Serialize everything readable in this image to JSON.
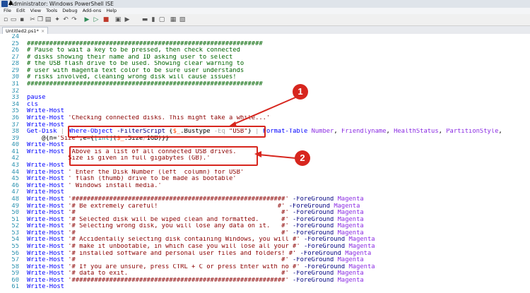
{
  "window": {
    "title": "Administrator: Windows PowerShell ISE"
  },
  "menu": [
    "File",
    "Edit",
    "View",
    "Tools",
    "Debug",
    "Add-ons",
    "Help"
  ],
  "toolbar": [
    "new-icon",
    "open-icon",
    "save-icon",
    "cut-icon",
    "copy-icon",
    "paste-icon",
    "clear-icon",
    "undo-icon",
    "redo-icon",
    "run-icon",
    "run-selection-icon",
    "stop-icon",
    "new-remote-tab-icon",
    "start-powershell-icon",
    "layout-top-icon",
    "layout-right-icon",
    "layout-max-icon",
    "show-console-icon",
    "show-commands-icon"
  ],
  "tab": {
    "name": "Untitled2.ps1*",
    "close": "×"
  },
  "lines": [
    {
      "num": "24",
      "tokens": []
    },
    {
      "num": "25",
      "tokens": [
        {
          "t": "cmt",
          "v": "###############################################################"
        }
      ]
    },
    {
      "num": "26",
      "tokens": [
        {
          "t": "cmt",
          "v": "# Pause to wait a key to be pressed, then check connected"
        }
      ]
    },
    {
      "num": "27",
      "tokens": [
        {
          "t": "cmt",
          "v": "# disks showing their name and ID asking user to select"
        }
      ]
    },
    {
      "num": "28",
      "tokens": [
        {
          "t": "cmt",
          "v": "# the USB flash drive to be used. Showing clear warning to"
        }
      ]
    },
    {
      "num": "29",
      "tokens": [
        {
          "t": "cmt",
          "v": "# user with magenta text color to be sure user understands"
        }
      ]
    },
    {
      "num": "30",
      "tokens": [
        {
          "t": "cmt",
          "v": "# risks involved, cleaning wrong disk will cause issues!"
        }
      ]
    },
    {
      "num": "31",
      "tokens": [
        {
          "t": "cmt",
          "v": "###############################################################"
        }
      ]
    },
    {
      "num": "32",
      "tokens": []
    },
    {
      "num": "33",
      "tokens": [
        {
          "t": "cmd",
          "v": "pause"
        }
      ]
    },
    {
      "num": "34",
      "tokens": [
        {
          "t": "cmd",
          "v": "cls"
        }
      ]
    },
    {
      "num": "35",
      "tokens": [
        {
          "t": "cmd",
          "v": "Write-Host"
        }
      ]
    },
    {
      "num": "36",
      "tokens": [
        {
          "t": "cmd",
          "v": "Write-Host"
        },
        {
          "t": "plain",
          "v": " "
        },
        {
          "t": "str",
          "v": "'Checking connected disks. This might take a while...'"
        }
      ]
    },
    {
      "num": "37",
      "tokens": [
        {
          "t": "cmd",
          "v": "Write-Host"
        }
      ]
    },
    {
      "num": "38",
      "tokens": [
        {
          "t": "cmd",
          "v": "Get-Disk"
        },
        {
          "t": "plain",
          "v": " "
        },
        {
          "t": "op",
          "v": "|"
        },
        {
          "t": "plain",
          "v": " "
        },
        {
          "t": "cmd",
          "v": "Where-Object"
        },
        {
          "t": "plain",
          "v": " "
        },
        {
          "t": "par",
          "v": "-FilterScript"
        },
        {
          "t": "plain",
          "v": " {"
        },
        {
          "t": "var",
          "v": "$_"
        },
        {
          "t": "plain",
          "v": "."
        },
        {
          "t": "plain",
          "v": "Bustype "
        },
        {
          "t": "op",
          "v": "-Eq"
        },
        {
          "t": "plain",
          "v": " "
        },
        {
          "t": "str",
          "v": "\"USB\""
        },
        {
          "t": "plain",
          "v": "} "
        },
        {
          "t": "op",
          "v": "|"
        },
        {
          "t": "plain",
          "v": " "
        },
        {
          "t": "cmd",
          "v": "Format-Table"
        },
        {
          "t": "plain",
          "v": " "
        },
        {
          "t": "arg",
          "v": "Number"
        },
        {
          "t": "plain",
          "v": ", "
        },
        {
          "t": "arg",
          "v": "Friendlyname"
        },
        {
          "t": "plain",
          "v": ", "
        },
        {
          "t": "arg",
          "v": "HealthStatus"
        },
        {
          "t": "plain",
          "v": ", "
        },
        {
          "t": "arg",
          "v": "PartitionStyle"
        },
        {
          "t": "plain",
          "v": ","
        }
      ]
    },
    {
      "num": "39",
      "tokens": [
        {
          "t": "plain",
          "v": "    @{n="
        },
        {
          "t": "str",
          "v": "'Size'"
        },
        {
          "t": "plain",
          "v": ";e={"
        },
        {
          "t": "typ",
          "v": "[int]"
        },
        {
          "t": "plain",
          "v": "("
        },
        {
          "t": "var",
          "v": "$_"
        },
        {
          "t": "plain",
          "v": ".Size"
        },
        {
          "t": "op",
          "v": "/"
        },
        {
          "t": "plain",
          "v": "1GB"
        },
        {
          "t": "plain",
          "v": ")}}"
        }
      ]
    },
    {
      "num": "40",
      "tokens": [
        {
          "t": "cmd",
          "v": "Write-Host"
        }
      ]
    },
    {
      "num": "41",
      "tokens": [
        {
          "t": "cmd",
          "v": "Write-Host"
        },
        {
          "t": "plain",
          "v": " "
        },
        {
          "t": "str",
          "v": "'Above is a list of all connected USB drives."
        }
      ]
    },
    {
      "num": "42",
      "tokens": [
        {
          "t": "str",
          "v": "           Size is given in full gigabytes (GB).'"
        }
      ]
    },
    {
      "num": "43",
      "tokens": [
        {
          "t": "cmd",
          "v": "Write-Host"
        }
      ]
    },
    {
      "num": "44",
      "tokens": [
        {
          "t": "cmd",
          "v": "Write-Host"
        },
        {
          "t": "plain",
          "v": " "
        },
        {
          "t": "str",
          "v": "' Enter the Disk Number (left  column) for USB'"
        }
      ]
    },
    {
      "num": "45",
      "tokens": [
        {
          "t": "cmd",
          "v": "Write-Host"
        },
        {
          "t": "plain",
          "v": " "
        },
        {
          "t": "str",
          "v": "' flash (thumb) drive to be made as bootable'"
        }
      ]
    },
    {
      "num": "46",
      "tokens": [
        {
          "t": "cmd",
          "v": "Write-Host"
        },
        {
          "t": "plain",
          "v": " "
        },
        {
          "t": "str",
          "v": "' Windows install media.'"
        }
      ]
    },
    {
      "num": "47",
      "tokens": [
        {
          "t": "cmd",
          "v": "Write-Host"
        }
      ]
    },
    {
      "num": "48",
      "tokens": [
        {
          "t": "cmd",
          "v": "Write-Host"
        },
        {
          "t": "plain",
          "v": " "
        },
        {
          "t": "str",
          "v": "'#########################################################'"
        },
        {
          "t": "plain",
          "v": " "
        },
        {
          "t": "par",
          "v": "-ForeGround"
        },
        {
          "t": "plain",
          "v": " "
        },
        {
          "t": "arg",
          "v": "Magenta"
        }
      ]
    },
    {
      "num": "49",
      "tokens": [
        {
          "t": "cmd",
          "v": "Write-Host"
        },
        {
          "t": "plain",
          "v": " "
        },
        {
          "t": "str",
          "v": "'# Be extremely careful!                                #'"
        },
        {
          "t": "plain",
          "v": " "
        },
        {
          "t": "par",
          "v": "-ForeGround"
        },
        {
          "t": "plain",
          "v": " "
        },
        {
          "t": "arg",
          "v": "Magenta"
        }
      ]
    },
    {
      "num": "50",
      "tokens": [
        {
          "t": "cmd",
          "v": "Write-Host"
        },
        {
          "t": "plain",
          "v": " "
        },
        {
          "t": "str",
          "v": "'#                                                       #'"
        },
        {
          "t": "plain",
          "v": " "
        },
        {
          "t": "par",
          "v": "-ForeGround"
        },
        {
          "t": "plain",
          "v": " "
        },
        {
          "t": "arg",
          "v": "Magenta"
        }
      ]
    },
    {
      "num": "51",
      "tokens": [
        {
          "t": "cmd",
          "v": "Write-Host"
        },
        {
          "t": "plain",
          "v": " "
        },
        {
          "t": "str",
          "v": "'# Selected disk will be wiped clean and formatted.      #'"
        },
        {
          "t": "plain",
          "v": " "
        },
        {
          "t": "par",
          "v": "-ForeGround"
        },
        {
          "t": "plain",
          "v": " "
        },
        {
          "t": "arg",
          "v": "Magenta"
        }
      ]
    },
    {
      "num": "52",
      "tokens": [
        {
          "t": "cmd",
          "v": "Write-Host"
        },
        {
          "t": "plain",
          "v": " "
        },
        {
          "t": "str",
          "v": "'# Selecting wrong disk, you will lose any data on it.   #'"
        },
        {
          "t": "plain",
          "v": " "
        },
        {
          "t": "par",
          "v": "-ForeGround"
        },
        {
          "t": "plain",
          "v": " "
        },
        {
          "t": "arg",
          "v": "Magenta"
        }
      ]
    },
    {
      "num": "53",
      "tokens": [
        {
          "t": "cmd",
          "v": "Write-Host"
        },
        {
          "t": "plain",
          "v": " "
        },
        {
          "t": "str",
          "v": "'#                                                       #'"
        },
        {
          "t": "plain",
          "v": " "
        },
        {
          "t": "par",
          "v": "-ForeGround"
        },
        {
          "t": "plain",
          "v": " "
        },
        {
          "t": "arg",
          "v": "Magenta"
        }
      ]
    },
    {
      "num": "54",
      "tokens": [
        {
          "t": "cmd",
          "v": "Write-Host"
        },
        {
          "t": "plain",
          "v": " "
        },
        {
          "t": "str",
          "v": "'# Accidentally selecting disk containing Windows, you will #'"
        },
        {
          "t": "plain",
          "v": " "
        },
        {
          "t": "par",
          "v": "-ForeGround"
        },
        {
          "t": "plain",
          "v": " "
        },
        {
          "t": "arg",
          "v": "Magenta"
        }
      ]
    },
    {
      "num": "55",
      "tokens": [
        {
          "t": "cmd",
          "v": "Write-Host"
        },
        {
          "t": "plain",
          "v": " "
        },
        {
          "t": "str",
          "v": "'# make it unbootable, in which case you will lose all your #'"
        },
        {
          "t": "plain",
          "v": " "
        },
        {
          "t": "par",
          "v": "-ForeGround"
        },
        {
          "t": "plain",
          "v": " "
        },
        {
          "t": "arg",
          "v": "Magenta"
        }
      ]
    },
    {
      "num": "56",
      "tokens": [
        {
          "t": "cmd",
          "v": "Write-Host"
        },
        {
          "t": "plain",
          "v": " "
        },
        {
          "t": "str",
          "v": "'# installed software and personal user files and folders! #'"
        },
        {
          "t": "plain",
          "v": " "
        },
        {
          "t": "par",
          "v": "-ForeGround"
        },
        {
          "t": "plain",
          "v": " "
        },
        {
          "t": "arg",
          "v": "Magenta"
        }
      ]
    },
    {
      "num": "57",
      "tokens": [
        {
          "t": "cmd",
          "v": "Write-Host"
        },
        {
          "t": "plain",
          "v": " "
        },
        {
          "t": "str",
          "v": "'#                                                       #'"
        },
        {
          "t": "plain",
          "v": " "
        },
        {
          "t": "par",
          "v": "-ForeGround"
        },
        {
          "t": "plain",
          "v": " "
        },
        {
          "t": "arg",
          "v": "Magenta"
        }
      ]
    },
    {
      "num": "58",
      "tokens": [
        {
          "t": "cmd",
          "v": "Write-Host"
        },
        {
          "t": "plain",
          "v": " "
        },
        {
          "t": "str",
          "v": "'# If you are unsure, press CTRL + C or press Enter with no #'"
        },
        {
          "t": "plain",
          "v": " "
        },
        {
          "t": "par",
          "v": "-ForeGround"
        },
        {
          "t": "plain",
          "v": " "
        },
        {
          "t": "arg",
          "v": "Magenta"
        }
      ]
    },
    {
      "num": "59",
      "tokens": [
        {
          "t": "cmd",
          "v": "Write-Host"
        },
        {
          "t": "plain",
          "v": " "
        },
        {
          "t": "str",
          "v": "'# data to exit.                                         #'"
        },
        {
          "t": "plain",
          "v": " "
        },
        {
          "t": "par",
          "v": "-ForeGround"
        },
        {
          "t": "plain",
          "v": " "
        },
        {
          "t": "arg",
          "v": "Magenta"
        }
      ]
    },
    {
      "num": "60",
      "tokens": [
        {
          "t": "cmd",
          "v": "Write-Host"
        },
        {
          "t": "plain",
          "v": " "
        },
        {
          "t": "str",
          "v": "'#########################################################'"
        },
        {
          "t": "plain",
          "v": " "
        },
        {
          "t": "par",
          "v": "-ForeGround"
        },
        {
          "t": "plain",
          "v": " "
        },
        {
          "t": "arg",
          "v": "Magenta"
        }
      ]
    },
    {
      "num": "61",
      "tokens": [
        {
          "t": "cmd",
          "v": "Write-Host"
        }
      ]
    }
  ],
  "annotations": [
    {
      "label": "1"
    },
    {
      "label": "2"
    }
  ],
  "colors": {
    "comment": "#006400",
    "command": "#0000ff",
    "string": "#8b0000",
    "parameter": "#000080",
    "argument": "#8a2be2",
    "annotation": "#d7261e"
  }
}
